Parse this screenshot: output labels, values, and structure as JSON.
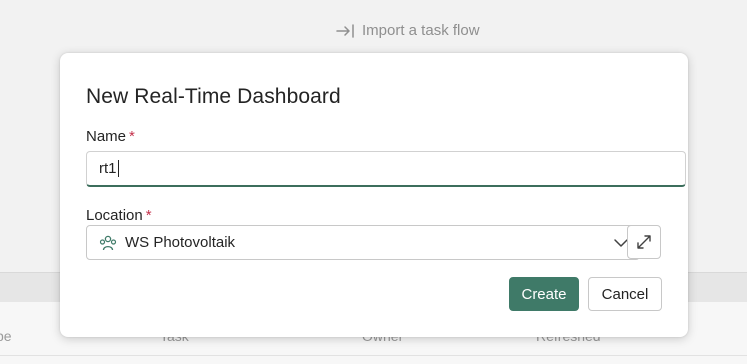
{
  "background": {
    "import_link": "Import a task flow",
    "columns": [
      {
        "label": "pe"
      },
      {
        "label": "Task"
      },
      {
        "label": "Owner"
      },
      {
        "label": "Refreshed"
      }
    ]
  },
  "dialog": {
    "title": "New Real-Time Dashboard",
    "name_label": "Name",
    "required_mark": "*",
    "name_value": "rt1",
    "location_label": "Location",
    "location_value": "WS Photovoltaik",
    "create_label": "Create",
    "cancel_label": "Cancel"
  },
  "colors": {
    "primary": "#3f7a68",
    "required": "#c4314b",
    "input_focus": "#3c6e5c"
  }
}
